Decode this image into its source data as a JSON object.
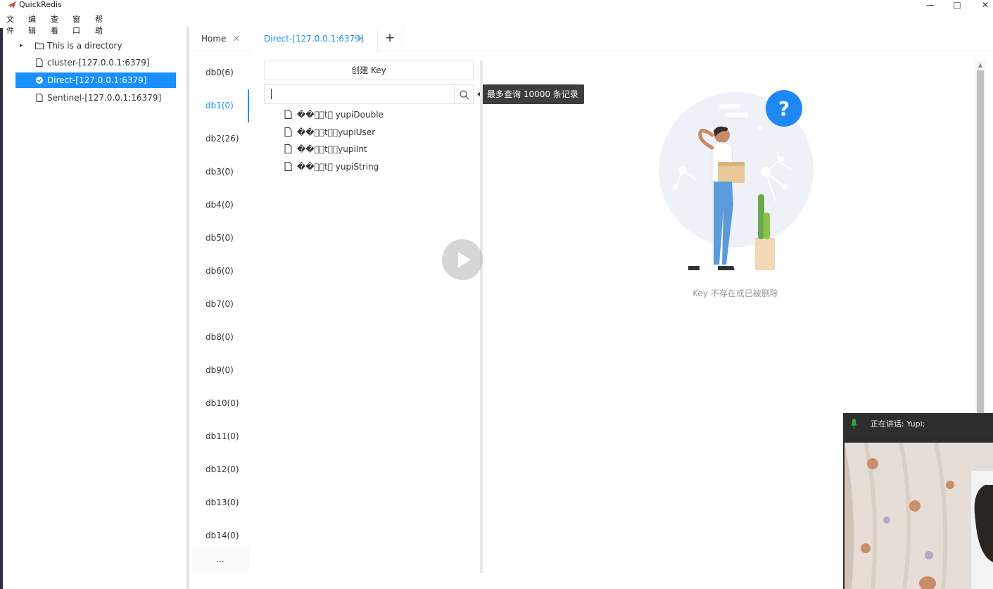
{
  "app": {
    "title": "QuickRedis"
  },
  "window_controls": {
    "minimize": "—",
    "maximize": "□",
    "close": "✕"
  },
  "menu": [
    "文件",
    "编辑",
    "查看",
    "窗口",
    "帮助"
  ],
  "tree": [
    {
      "label": "This is a directory",
      "icon": "folder-icon",
      "caret": "▸"
    },
    {
      "label": "cluster-[127.0.0.1:6379]",
      "icon": "file-icon"
    },
    {
      "label": "Direct-[127.0.0.1:6379]",
      "icon": "check-circle-icon",
      "selected": true
    },
    {
      "label": "Sentinel-[127.0.0.1:16379]",
      "icon": "file-icon"
    }
  ],
  "tabs": {
    "home": {
      "label": "Home",
      "close": "✕"
    },
    "direct": {
      "label": "Direct-[127.0.0.1:6379]",
      "close": "✕"
    },
    "add": "+"
  },
  "databases": [
    {
      "label": "db0(6)"
    },
    {
      "label": "db1(0)",
      "active": true
    },
    {
      "label": "db2(26)"
    },
    {
      "label": "db3(0)"
    },
    {
      "label": "db4(0)"
    },
    {
      "label": "db5(0)"
    },
    {
      "label": "db6(0)"
    },
    {
      "label": "db7(0)"
    },
    {
      "label": "db8(0)"
    },
    {
      "label": "db9(0)"
    },
    {
      "label": "db10(0)"
    },
    {
      "label": "db11(0)"
    },
    {
      "label": "db12(0)"
    },
    {
      "label": "db13(0)"
    },
    {
      "label": "db14(0)"
    }
  ],
  "db_more": "...",
  "key_panel": {
    "create_key": "创建 Key",
    "search_value": "",
    "tooltip": "最多查询 10000 条记录",
    "keys": [
      "��\u0000\u0005t\u0000 yupiDouble",
      "��\u0000\u0005t\u0000\byupiUser",
      "��\u0000\u0005t\u0000\u0007yupiInt",
      "��\u0000\u0005t\u0000 yupiString"
    ]
  },
  "empty_state": {
    "text": "Key 不存在或已被删除",
    "badge": "?"
  },
  "call": {
    "status": "正在讲话: Yupi;"
  },
  "colors": {
    "accent": "#1890ff",
    "tooltip_bg": "#3d3d3d"
  }
}
